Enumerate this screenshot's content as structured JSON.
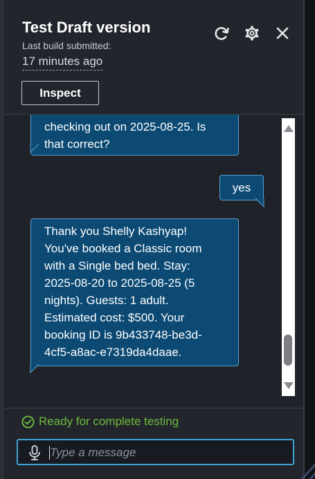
{
  "header": {
    "title": "Test Draft version",
    "subtitle": "Last build submitted:",
    "timestamp": "17 minutes ago",
    "inspect_label": "Inspect"
  },
  "icons": {
    "refresh": "refresh-icon",
    "settings": "gear-icon",
    "close": "close-icon",
    "status": "check-circle-icon",
    "microphone": "microphone-icon"
  },
  "chat": {
    "messages": [
      {
        "sender": "bot",
        "lines": [
          "checking out on 2025-08-25. Is",
          "that correct?"
        ]
      },
      {
        "sender": "user",
        "lines": [
          "yes"
        ]
      },
      {
        "sender": "bot",
        "lines": [
          "Thank you Shelly Kashyap!",
          "You've booked a Classic room",
          "with a Single bed bed. Stay:",
          "2025-08-20 to 2025-08-25 (5",
          "nights). Guests: 1 adult.",
          "Estimated cost: $500. Your",
          "booking ID is 9b433748-be3d-",
          "4cf5-a8ac-e7319da4daae."
        ]
      }
    ]
  },
  "footer": {
    "status_text": "Ready for complete testing",
    "input_placeholder": "Type a message",
    "input_value": ""
  },
  "colors": {
    "panel_bg": "#22262c",
    "bubble_bg": "#0c4a74",
    "bubble_border": "#5d9fd0",
    "status_green": "#6fba3d",
    "input_focus": "#3fa3d3"
  }
}
